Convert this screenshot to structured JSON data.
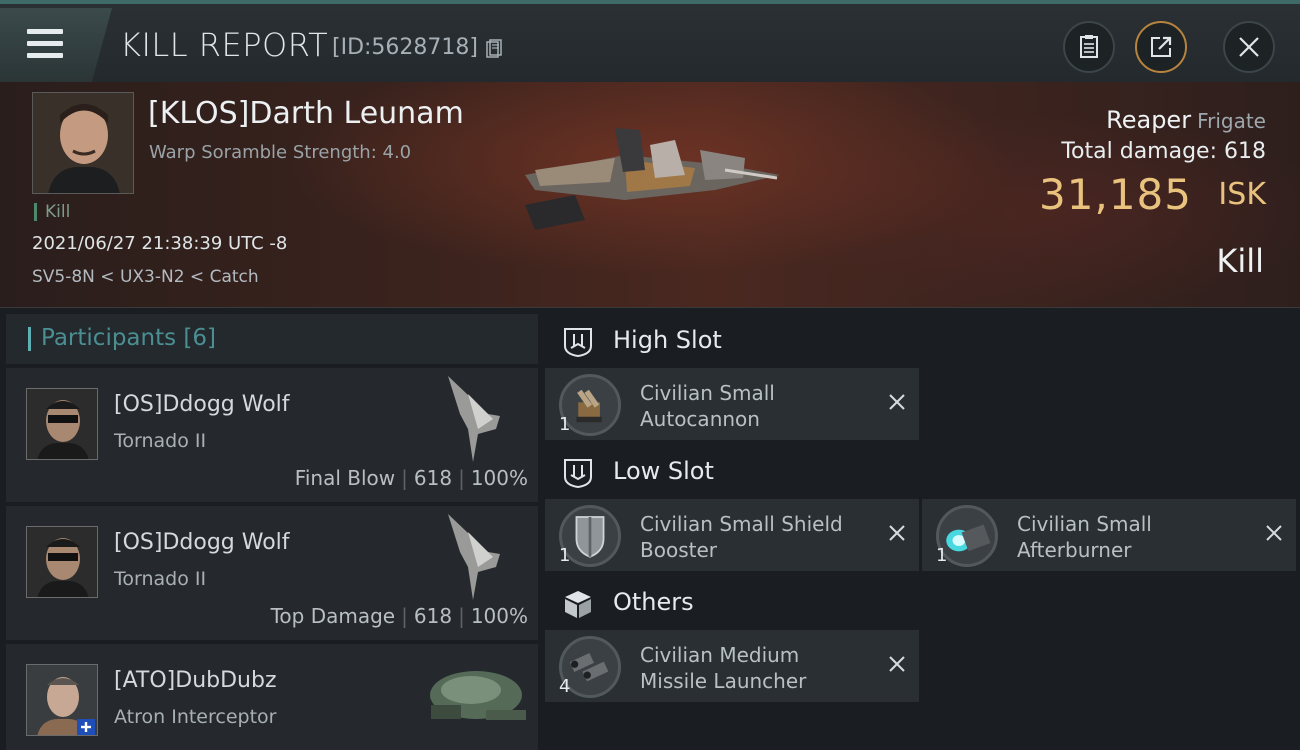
{
  "header": {
    "title": "KILL REPORT",
    "report_id": "[ID:5628718]",
    "buttons": [
      "clipboard-icon",
      "share-icon",
      "close-icon"
    ]
  },
  "victim": {
    "name": "[KLOS]Darth Leunam",
    "scramble": "Warp Soramble Strength: 4.0",
    "kill_tag": "Kill",
    "timestamp": "2021/06/27 21:38:39 UTC -8",
    "route": "SV5-8N < UX3-N2 < Catch",
    "ship": "Reaper",
    "ship_class": "Frigate",
    "total_damage": "Total damage:  618",
    "isk_value": "31,185",
    "isk_unit": "ISK",
    "kill_type": "Kill"
  },
  "participants": {
    "label": "Participants [6]",
    "rows": [
      {
        "name": "[OS]Ddogg Wolf",
        "ship": "Tornado II",
        "role": "Final Blow",
        "damage": "618",
        "percent": "100%"
      },
      {
        "name": "[OS]Ddogg Wolf",
        "ship": "Tornado II",
        "role": "Top Damage",
        "damage": "618",
        "percent": "100%"
      },
      {
        "name": "[ATO]DubDubz",
        "ship": "Atron Interceptor",
        "role": "",
        "damage": "",
        "percent": ""
      }
    ]
  },
  "slots": {
    "high": {
      "label": "High Slot",
      "modules": [
        {
          "qty": "1",
          "name": "Civilian Small Autocannon"
        }
      ]
    },
    "low": {
      "label": "Low Slot",
      "modules": [
        {
          "qty": "1",
          "name": "Civilian Small Shield Booster"
        },
        {
          "qty": "1",
          "name": "Civilian Small Afterburner"
        }
      ]
    },
    "others": {
      "label": "Others",
      "modules": [
        {
          "qty": "4",
          "name": "Civilian Medium Missile Launcher"
        }
      ]
    }
  },
  "colors": {
    "accent_teal": "#5fb0b2",
    "isk_gold": "#e9c37e",
    "panel": "#25292d"
  }
}
